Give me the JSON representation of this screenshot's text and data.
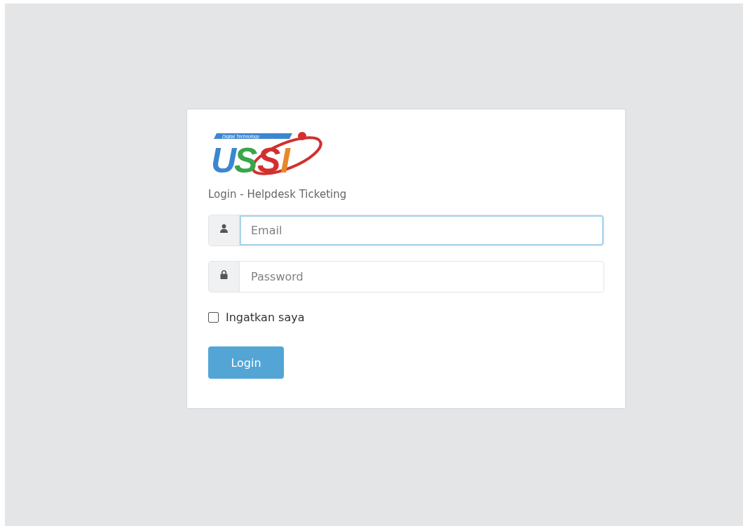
{
  "logo": {
    "tagline": "Digital Technology",
    "wordmark": "USSI"
  },
  "title": "Login - Helpdesk Ticketing",
  "fields": [
    {
      "kind": "user",
      "placeholder": "Email",
      "focused": true
    },
    {
      "kind": "lock",
      "placeholder": "Password",
      "focused": false
    }
  ],
  "remember": {
    "label": "Ingatkan saya",
    "checked": false
  },
  "button": "Login"
}
